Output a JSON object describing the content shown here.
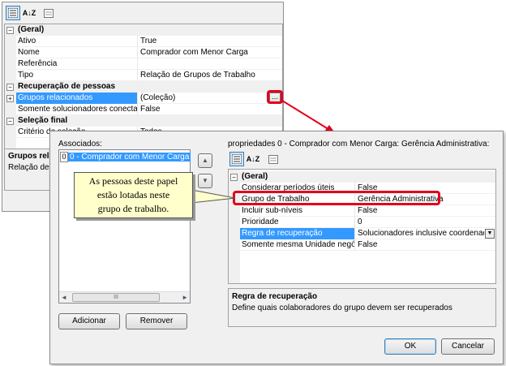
{
  "back_window": {
    "toolbar_icons": [
      "categorized-icon",
      "alphabetical-icon",
      "property-pages-icon"
    ],
    "alpha_glyph": "A↓Z",
    "sections": [
      {
        "label": "(Geral)",
        "rows": [
          {
            "name": "Ativo",
            "value": "True"
          },
          {
            "name": "Nome",
            "value": "Comprador com Menor Carga"
          },
          {
            "name": "Referência",
            "value": ""
          },
          {
            "name": "Tipo",
            "value": "Relação de Grupos de Trabalho"
          }
        ]
      },
      {
        "label": "Recuperação de pessoas",
        "rows": [
          {
            "name": "Grupos relacionados",
            "value": "(Coleção)"
          },
          {
            "name": "Somente solucionadores conectad",
            "value": "False"
          }
        ]
      },
      {
        "label": "Seleção final",
        "rows": [
          {
            "name": "Critério de seleção",
            "value": "Todos"
          }
        ]
      }
    ],
    "ellipsis_label": "...",
    "description_title": "Grupos rel",
    "description_text": "Relação de"
  },
  "dialog": {
    "associados_label": "Associados:",
    "list_items": [
      {
        "index": "0",
        "text": "0 - Comprador com Menor Carga"
      }
    ],
    "move_up_glyph": "▲",
    "move_down_glyph": "▼",
    "scroll_left_glyph": "◄",
    "scroll_right_glyph": "►",
    "scroll_thumb_glyph": "III",
    "add_button": "Adicionar",
    "remove_button": "Remover",
    "props_title": "propriedades 0 - Comprador com Menor Carga: Gerência Administrativa:",
    "section_label": "(Geral)",
    "rows": [
      {
        "name": "Considerar períodos úteis",
        "value": "False"
      },
      {
        "name": "Grupo de Trabalho",
        "value": "Gerência Administrativa"
      },
      {
        "name": "Incluir sub-níveis",
        "value": "False"
      },
      {
        "name": "Prioridade",
        "value": "0"
      },
      {
        "name": "Regra de recuperação",
        "value": "Solucionadores inclusive coordenador"
      },
      {
        "name": "Somente mesma Unidade negócio",
        "value": "False"
      }
    ],
    "dropdown_glyph": "▼",
    "description_title": "Regra de recuperação",
    "description_text": "Define quais colaboradores do grupo devem ser recuperados",
    "ok_button": "OK",
    "cancel_button": "Cancelar"
  },
  "callout": {
    "lines": [
      "As pessoas deste papel",
      "estão lotadas neste",
      "grupo de trabalho."
    ]
  },
  "colors": {
    "highlight": "#e2001a",
    "selection": "#3399ff",
    "callout_bg": "#ffffcc"
  }
}
